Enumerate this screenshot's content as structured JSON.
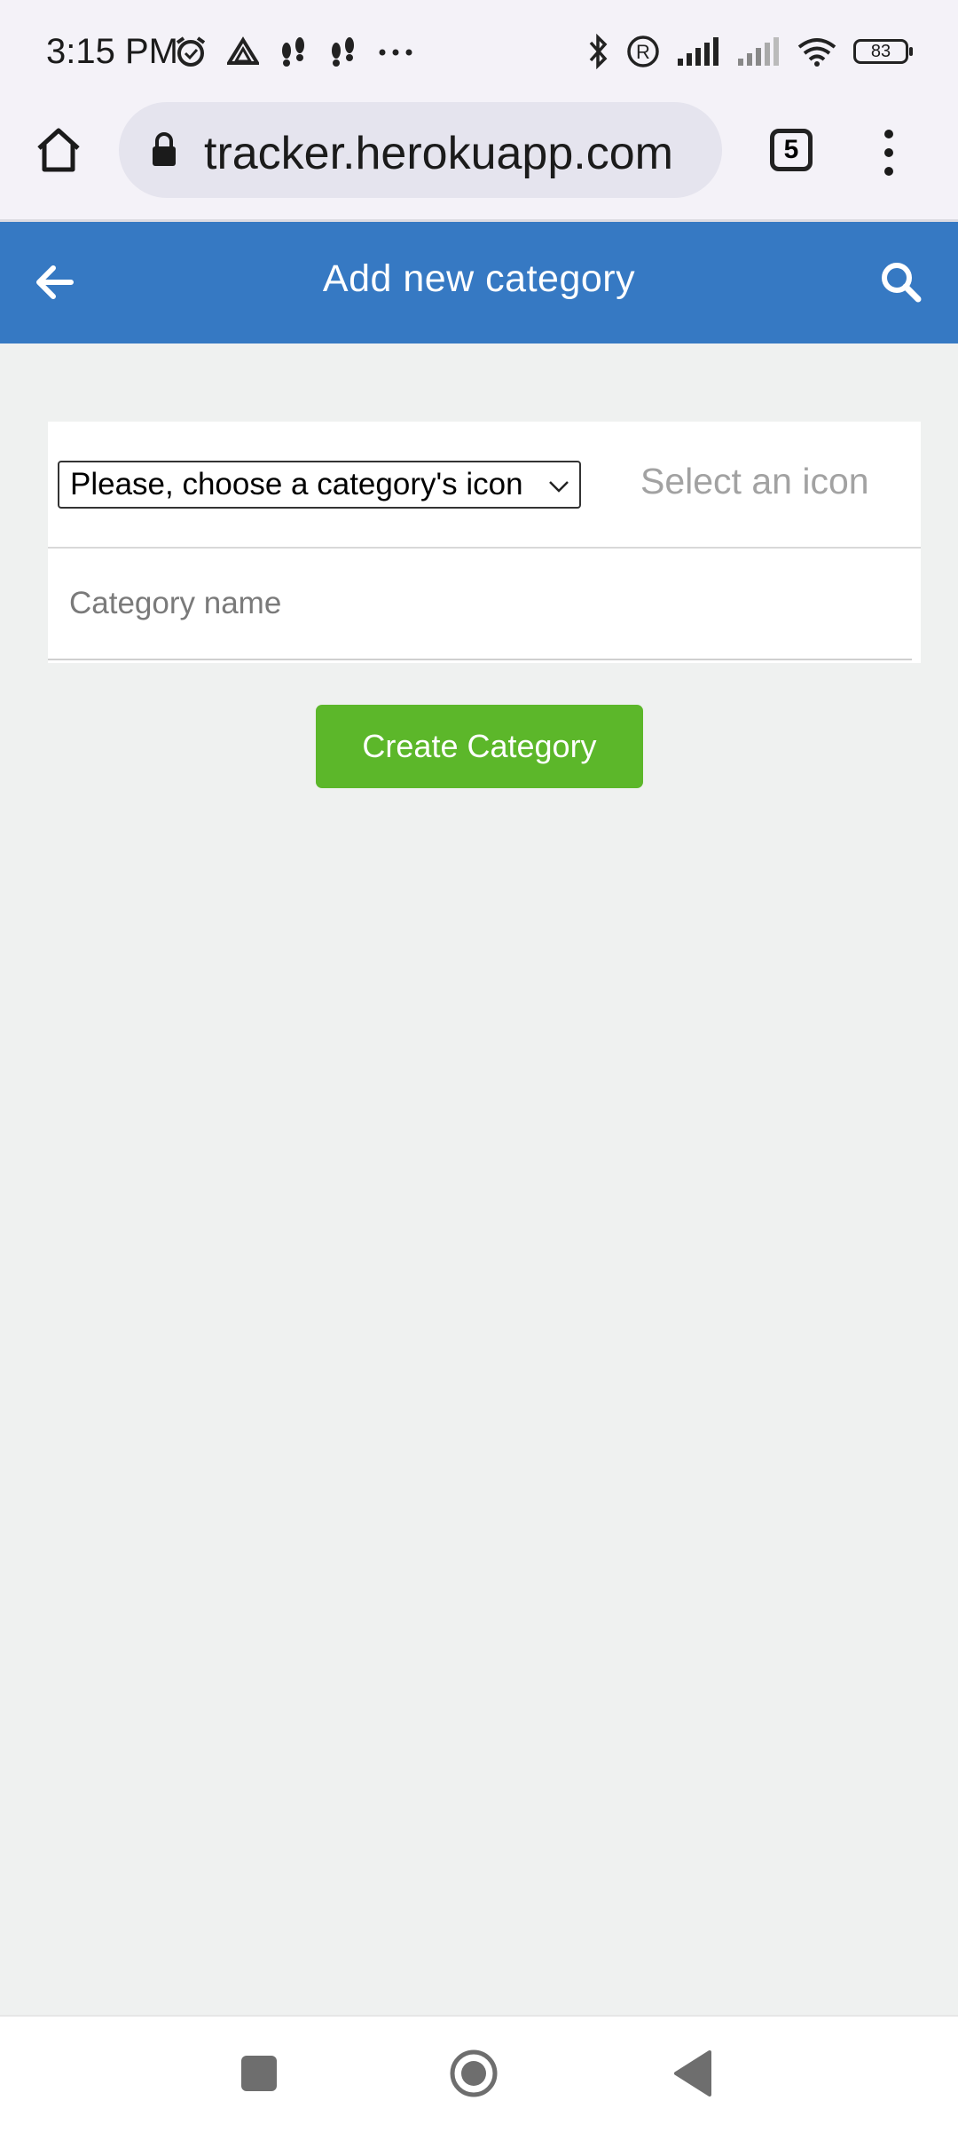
{
  "status_bar": {
    "time": "3:15 PM",
    "battery": "83",
    "left_icons": [
      "alarm-icon",
      "drive-icon",
      "footsteps-icon",
      "footsteps-icon",
      "more-icon"
    ],
    "right_icons": [
      "bluetooth-icon",
      "registered-icon",
      "signal-icon",
      "signal-icon",
      "wifi-icon",
      "battery-icon"
    ]
  },
  "browser": {
    "url": "tracker.herokuapp.com",
    "tab_count": "5"
  },
  "header": {
    "title": "Add new category"
  },
  "form": {
    "icon_select_value": "Please, choose a category's icon",
    "icon_placeholder": "Select an icon",
    "name_placeholder": "Category name",
    "submit_label": "Create Category"
  },
  "colors": {
    "header_bg": "#3679c3",
    "button_bg": "#5cb72a",
    "page_bg": "#eff1f0"
  }
}
